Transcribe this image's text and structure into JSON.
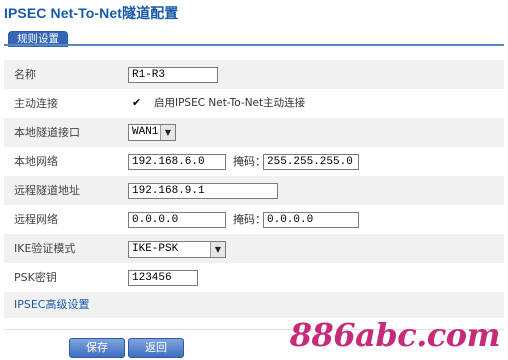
{
  "page_title": "IPSEC Net-To-Net隧道配置",
  "tab": {
    "label": "规则设置"
  },
  "form": {
    "name": {
      "label": "名称",
      "value": "R1-R3"
    },
    "active_connect": {
      "label": "主动连接",
      "checked": true,
      "checkbox_mark": "✔",
      "text": "启用IPSEC Net-To-Net主动连接"
    },
    "local_tunnel_iface": {
      "label": "本地隧道接口",
      "value": "WAN1"
    },
    "local_network": {
      "label": "本地网络",
      "value": "192.168.6.0",
      "mask_label": "掩码：",
      "mask_value": "255.255.255.0"
    },
    "remote_tunnel_addr": {
      "label": "远程隧道地址",
      "value": "192.168.9.1"
    },
    "remote_network": {
      "label": "远程网络",
      "value": "0.0.0.0",
      "mask_label": "掩码：",
      "mask_value": "0.0.0.0"
    },
    "ike_mode": {
      "label": "IKE验证模式",
      "value": "IKE-PSK"
    },
    "psk": {
      "label": "PSK密钥",
      "value": "123456"
    },
    "advanced_link": "IPSEC高级设置"
  },
  "buttons": {
    "save": "保存",
    "back": "返回"
  },
  "watermark": "886abc.com",
  "colors": {
    "accent": "#3566b4",
    "title": "#1a5aa8",
    "watermark": "#c21a6f",
    "row_alt": "#f1f1f1"
  }
}
